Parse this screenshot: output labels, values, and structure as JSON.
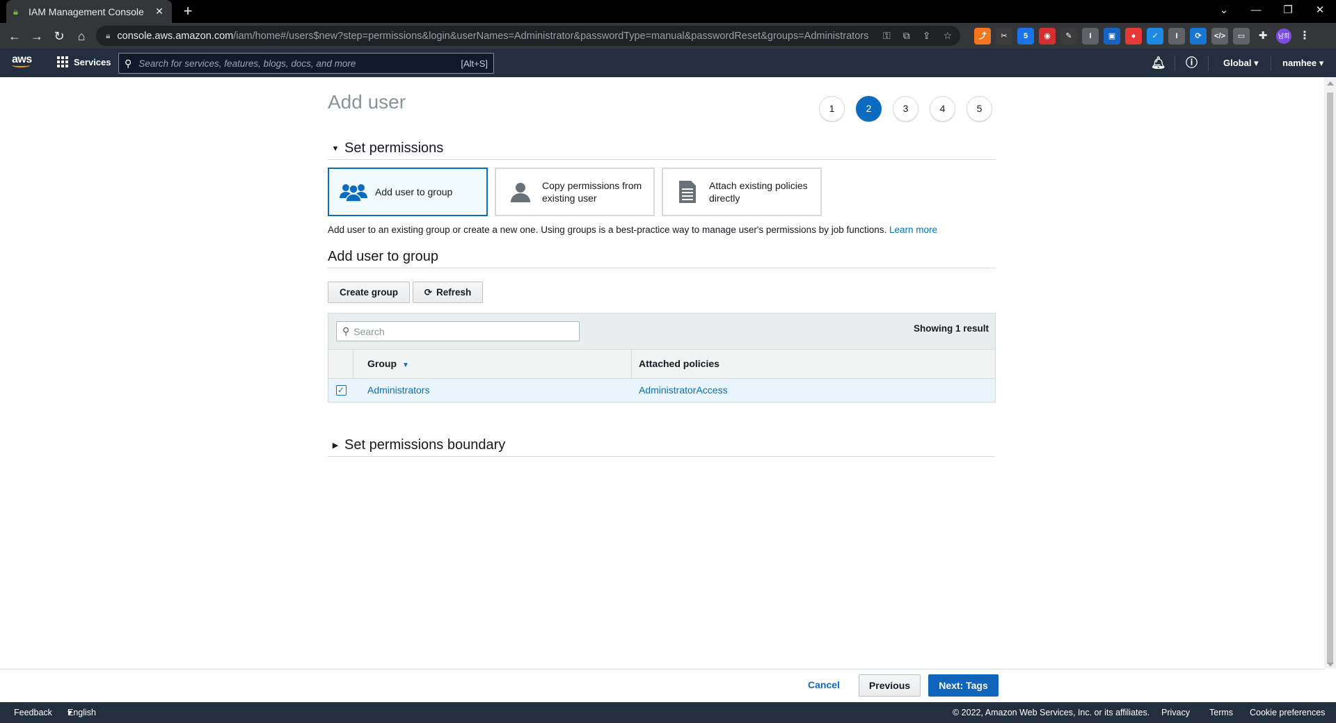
{
  "browser": {
    "tab_title": "IAM Management Console",
    "url_host": "console.aws.amazon.com",
    "url_path": "/iam/home#/users$new?step=permissions&login&userNames=Administrator&passwordType=manual&passwordReset&groups=Administrators",
    "profile_initials": "남희"
  },
  "awsnav": {
    "logo": "aws",
    "services_label": "Services",
    "search_placeholder": "Search for services, features, blogs, docs, and more",
    "search_shortcut": "[Alt+S]",
    "region": "Global",
    "user": "namhee"
  },
  "page": {
    "title": "Add user",
    "steps": [
      "1",
      "2",
      "3",
      "4",
      "5"
    ],
    "active_step": "2"
  },
  "permissions": {
    "section_title": "Set permissions",
    "options": [
      {
        "label": "Add user to group",
        "selected": true
      },
      {
        "label_line1": "Copy permissions from",
        "label_line2": "existing user",
        "selected": false
      },
      {
        "label_line1": "Attach existing policies",
        "label_line2": "directly",
        "selected": false
      }
    ],
    "description": "Add user to an existing group or create a new one. Using groups is a best-practice way to manage user's permissions by job functions.",
    "learn_more": "Learn more"
  },
  "group_section": {
    "title": "Add user to group",
    "create_button": "Create group",
    "refresh_button": "Refresh",
    "search_placeholder": "Search",
    "showing": "Showing 1 result",
    "columns": [
      "Group",
      "Attached policies"
    ],
    "rows": [
      {
        "group": "Administrators",
        "policies": "AdministratorAccess",
        "checked": true
      }
    ]
  },
  "boundary": {
    "title": "Set permissions boundary"
  },
  "actions": {
    "cancel": "Cancel",
    "previous": "Previous",
    "next": "Next: Tags"
  },
  "footer": {
    "feedback": "Feedback",
    "language": "English (US)",
    "copyright": "© 2022, Amazon Web Services, Inc. or its affiliates.",
    "privacy": "Privacy",
    "terms": "Terms",
    "cookies": "Cookie preferences"
  },
  "colors": {
    "aws_nav": "#232f3e",
    "primary": "#0a6bbf",
    "link": "#0073bb"
  }
}
